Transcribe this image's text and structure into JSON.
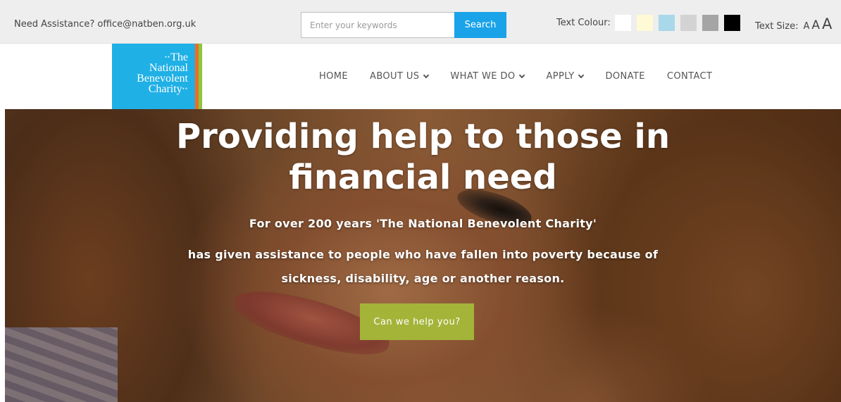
{
  "topbar": {
    "assistance_label": "Need Assistance?",
    "assistance_email": "office@natben.org.uk",
    "search": {
      "placeholder": "Enter your keywords",
      "button_label": "Search",
      "button_color": "#1aa3e8"
    },
    "text_colour": {
      "label": "Text Colour:",
      "swatches": [
        "#ffffff",
        "#fdfad5",
        "#a8d8ea",
        "#d3d3d3",
        "#a5a5a5",
        "#000000"
      ]
    },
    "text_size": {
      "label": "Text Size:",
      "options": [
        "A",
        "A",
        "A"
      ]
    }
  },
  "logo": {
    "line1": "The",
    "line2": "National",
    "line3": "Benevolent",
    "line4": "Charity",
    "background": "#1fb0e6",
    "strip_colors": [
      "#f26b21",
      "#8cc63f"
    ]
  },
  "nav": {
    "items": [
      {
        "label": "HOME",
        "dropdown": false
      },
      {
        "label": "ABOUT US",
        "dropdown": true
      },
      {
        "label": "WHAT WE DO",
        "dropdown": true
      },
      {
        "label": "APPLY",
        "dropdown": true
      },
      {
        "label": "DONATE",
        "dropdown": false
      },
      {
        "label": "CONTACT",
        "dropdown": false
      }
    ]
  },
  "hero": {
    "title_line1": "Providing help to those in",
    "title_line2": "financial need",
    "subtitle1": "For over 200 years 'The National Benevolent Charity'",
    "subtitle2": "has given assistance to people who have fallen into poverty because of",
    "subtitle3": "sickness, disability, age or another reason.",
    "cta_label": "Can we help you?",
    "cta_color": "#a3b439"
  }
}
